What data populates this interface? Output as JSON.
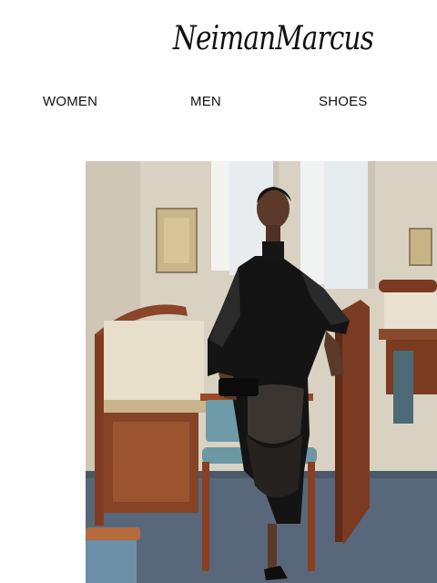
{
  "brand": {
    "logo_text": "NeimanMarcus"
  },
  "nav": {
    "items": [
      {
        "label": "WOMEN"
      },
      {
        "label": "MEN"
      },
      {
        "label": "SHOES"
      }
    ]
  },
  "hero": {
    "image": "editorial-photo-model-in-black-lace-dress-in-library"
  }
}
